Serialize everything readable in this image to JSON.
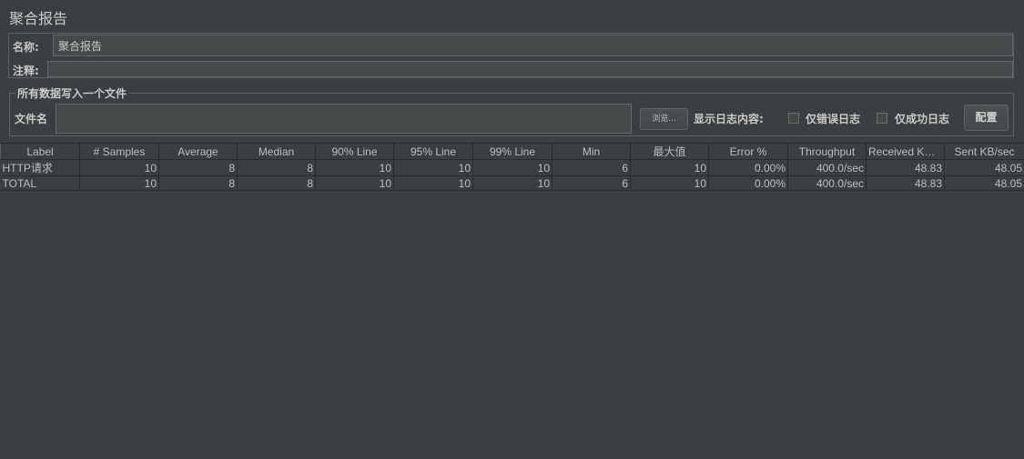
{
  "title": "聚合报告",
  "name": {
    "label": "名称:",
    "value": "聚合报告"
  },
  "comment": {
    "label": "注释:",
    "value": ""
  },
  "file_section": {
    "legend": "所有数据写入一个文件",
    "filename_label": "文件名",
    "filename_value": "",
    "browse_label": "浏览...",
    "log_content_label": "显示日志内容:",
    "errors_only_label": "仅错误日志",
    "success_only_label": "仅成功日志",
    "configure_label": "配置",
    "errors_only_checked": false,
    "success_only_checked": false
  },
  "table": {
    "columns": [
      "Label",
      "# Samples",
      "Average",
      "Median",
      "90% Line",
      "95% Line",
      "99% Line",
      "Min",
      "最大值",
      "Error %",
      "Throughput",
      "Received KB/...",
      "Sent KB/sec"
    ],
    "rows": [
      [
        "HTTP请求",
        "10",
        "8",
        "8",
        "10",
        "10",
        "10",
        "6",
        "10",
        "0.00%",
        "400.0/sec",
        "48.83",
        "48.05"
      ],
      [
        "TOTAL",
        "10",
        "8",
        "8",
        "10",
        "10",
        "10",
        "6",
        "10",
        "0.00%",
        "400.0/sec",
        "48.83",
        "48.05"
      ]
    ]
  },
  "colors": {
    "background": "#3c3f41",
    "field": "#45494a",
    "text": "#bbbbbb",
    "border": "#5e6060"
  }
}
